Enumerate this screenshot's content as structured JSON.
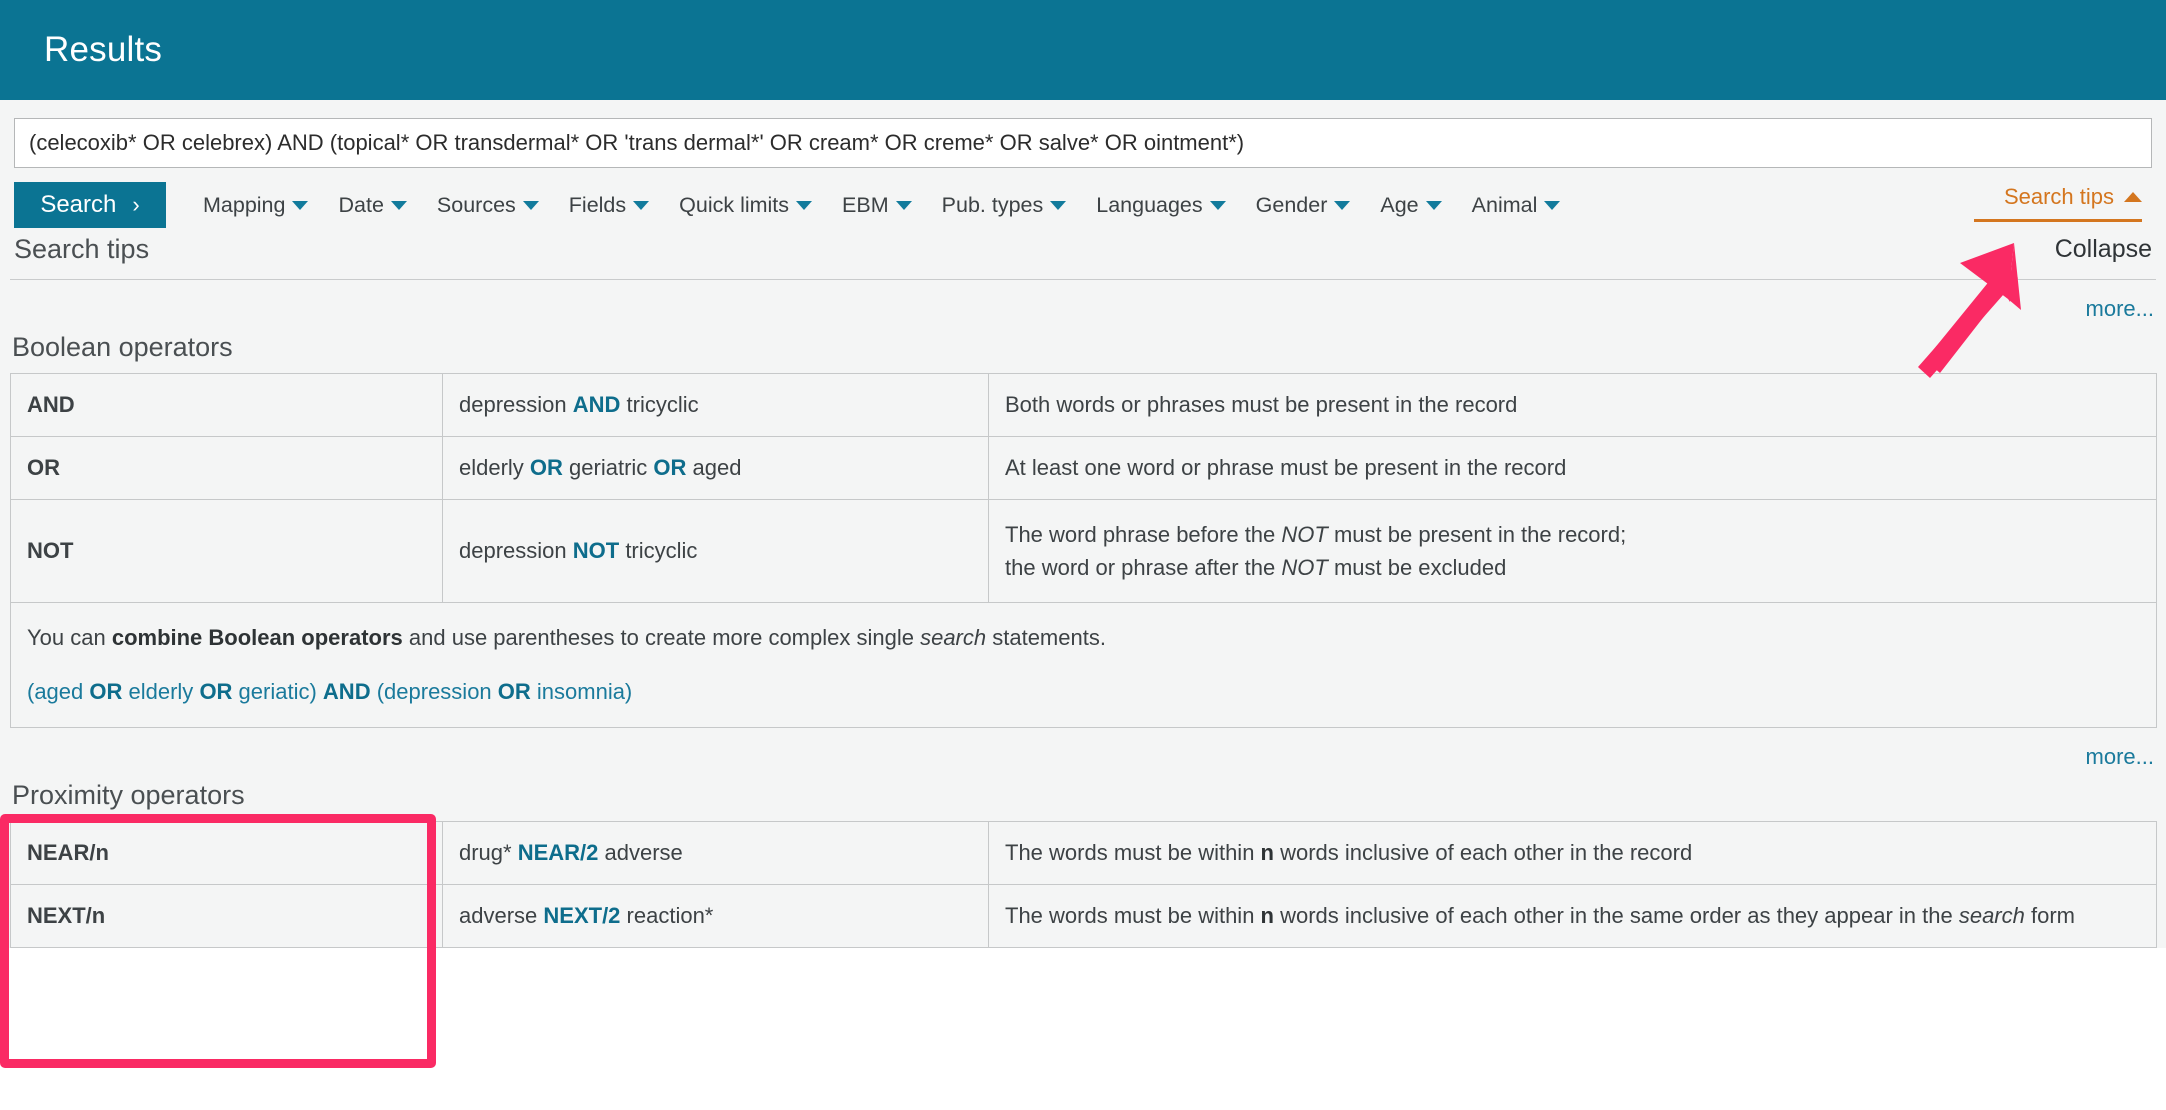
{
  "header": {
    "title": "Results"
  },
  "search": {
    "query": "(celecoxib* OR celebrex) AND (topical* OR transdermal* OR 'trans dermal*' OR cream* OR creme* OR salve* OR ointment*)",
    "placeholder": "",
    "button_label": "Search",
    "button_chevron": "›",
    "menus": [
      {
        "label": "Mapping"
      },
      {
        "label": "Date"
      },
      {
        "label": "Sources"
      },
      {
        "label": "Fields"
      },
      {
        "label": "Quick limits"
      },
      {
        "label": "EBM"
      },
      {
        "label": "Pub. types"
      },
      {
        "label": "Languages"
      },
      {
        "label": "Gender"
      },
      {
        "label": "Age"
      },
      {
        "label": "Animal"
      }
    ],
    "tips_toggle_label": "Search tips"
  },
  "tips": {
    "heading": "Search tips",
    "collapse_label": "Collapse",
    "more_label_1": "more...",
    "more_label_2": "more...",
    "boolean": {
      "title": "Boolean operators",
      "rows": [
        {
          "operator": "AND",
          "example_pre": "depression ",
          "example_op": "AND",
          "example_post": " tricyclic",
          "desc_line1": "Both words or phrases must be present in the record",
          "desc_line2": ""
        },
        {
          "operator": "OR",
          "example_pre": "elderly ",
          "example_op": "OR",
          "example_mid": " geriatric ",
          "example_op2": "OR",
          "example_post": " aged",
          "desc_line1": "At least one word or phrase must be present in the record",
          "desc_line2": ""
        },
        {
          "operator": "NOT",
          "example_pre": "depression ",
          "example_op": "NOT",
          "example_post": " tricyclic",
          "desc_line1_a": "The word phrase before the ",
          "desc_line1_em": "NOT",
          "desc_line1_b": " must be present in the record;",
          "desc_line2_a": "the word or phrase after the ",
          "desc_line2_em": "NOT",
          "desc_line2_b": " must be excluded"
        }
      ],
      "combine": {
        "text_a": "You can ",
        "text_bold": "combine Boolean operators",
        "text_b": " and use parentheses to create more complex single ",
        "text_em": "search",
        "text_c": " statements.",
        "ex_a": "(aged ",
        "ex_op1": "OR",
        "ex_b": " elderly ",
        "ex_op2": "OR",
        "ex_c": " geriatic) ",
        "ex_op3": "AND",
        "ex_d": " (depression ",
        "ex_op4": "OR",
        "ex_e": " insomnia)"
      }
    },
    "proximity": {
      "title": "Proximity operators",
      "rows": [
        {
          "operator": "NEAR/n",
          "example_pre": "drug* ",
          "example_op": "NEAR/2",
          "example_post": " adverse",
          "desc_a": "The words must be within ",
          "desc_bold": "n",
          "desc_b": " words inclusive of each other in the record",
          "desc_line2": ""
        },
        {
          "operator": "NEXT/n",
          "example_pre": "adverse ",
          "example_op": "NEXT/2",
          "example_post": " reaction*",
          "desc_a": "The words must be within ",
          "desc_bold": "n",
          "desc_b": " words inclusive of each other in the same order as they appear in the ",
          "desc_em": "search",
          "desc_c": " form"
        }
      ]
    }
  },
  "colors": {
    "header_teal": "#0b7493",
    "link_blue": "#1a7a9c",
    "tips_orange": "#d4761f",
    "annotation_pink": "#fa2a64",
    "panel_grey": "#f4f5f5"
  }
}
